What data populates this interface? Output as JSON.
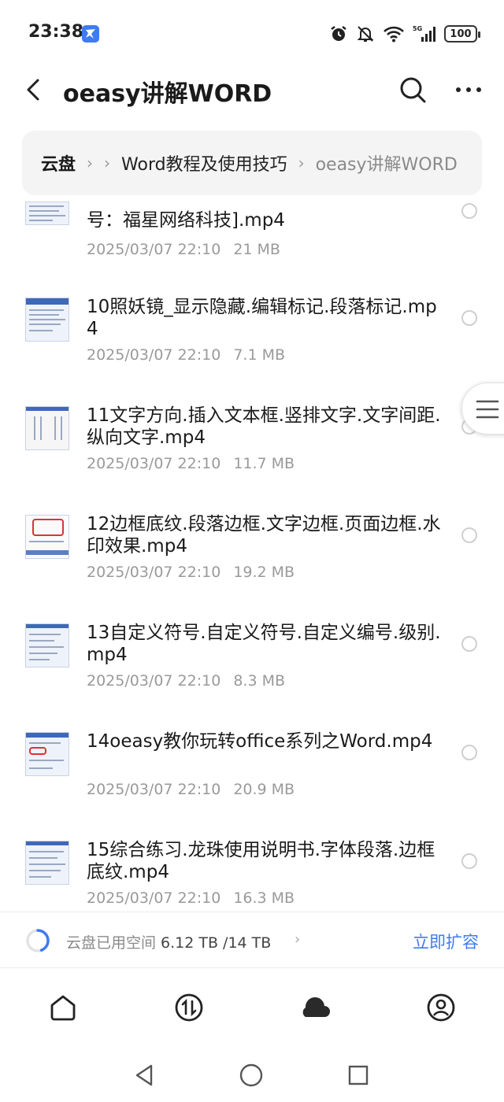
{
  "status_bar": {
    "time": "23:38",
    "app_icon": "bird-app-icon",
    "icons": [
      "alarm-icon",
      "bell-off-icon",
      "wifi-icon",
      "signal-5g-icon"
    ],
    "signal_label": "5G",
    "battery": "100"
  },
  "header": {
    "title": "oeasy讲解WORD",
    "back_icon": "back-arrow-icon",
    "search_icon": "search-icon",
    "more_icon": "more-dots-icon"
  },
  "breadcrumb": {
    "root": "云盘",
    "items": [
      "Word教程及使用技巧"
    ],
    "current": "oeasy讲解WORD"
  },
  "files": [
    {
      "name": "号：福星网络科技].mp4",
      "date": "2025/03/07 22:10",
      "size": "21 MB"
    },
    {
      "name": "10照妖镜_显示隐藏.编辑标记.段落标记.mp4",
      "date": "2025/03/07 22:10",
      "size": "7.1 MB"
    },
    {
      "name": "11文字方向.插入文本框.竖排文字.文字间距.纵向文字.mp4",
      "date": "2025/03/07 22:10",
      "size": "11.7 MB"
    },
    {
      "name": "12边框底纹.段落边框.文字边框.页面边框.水印效果.mp4",
      "date": "2025/03/07 22:10",
      "size": "19.2 MB"
    },
    {
      "name": "13自定义符号.自定义符号.自定义编号.级别.mp4",
      "date": "2025/03/07 22:10",
      "size": "8.3 MB"
    },
    {
      "name": "14oeasy教你玩转office系列之Word.mp4",
      "date": "2025/03/07 22:10",
      "size": "20.9 MB"
    },
    {
      "name": "15综合练习.龙珠使用说明书.字体段落.边框底纹.mp4",
      "date": "2025/03/07 22:10",
      "size": "16.3 MB"
    }
  ],
  "storage": {
    "label": "云盘已用空间",
    "value": "6.12 TB /14 TB",
    "used_fraction": 0.44,
    "action": "立即扩容"
  },
  "bottom_nav": [
    "home-icon",
    "transfer-icon",
    "cloud-icon",
    "profile-icon"
  ],
  "colors": {
    "accent": "#3d7cf2",
    "text": "#1a1a1a",
    "meta": "#9a9a9a",
    "breadcrumb_bg": "#f4f4f5"
  }
}
